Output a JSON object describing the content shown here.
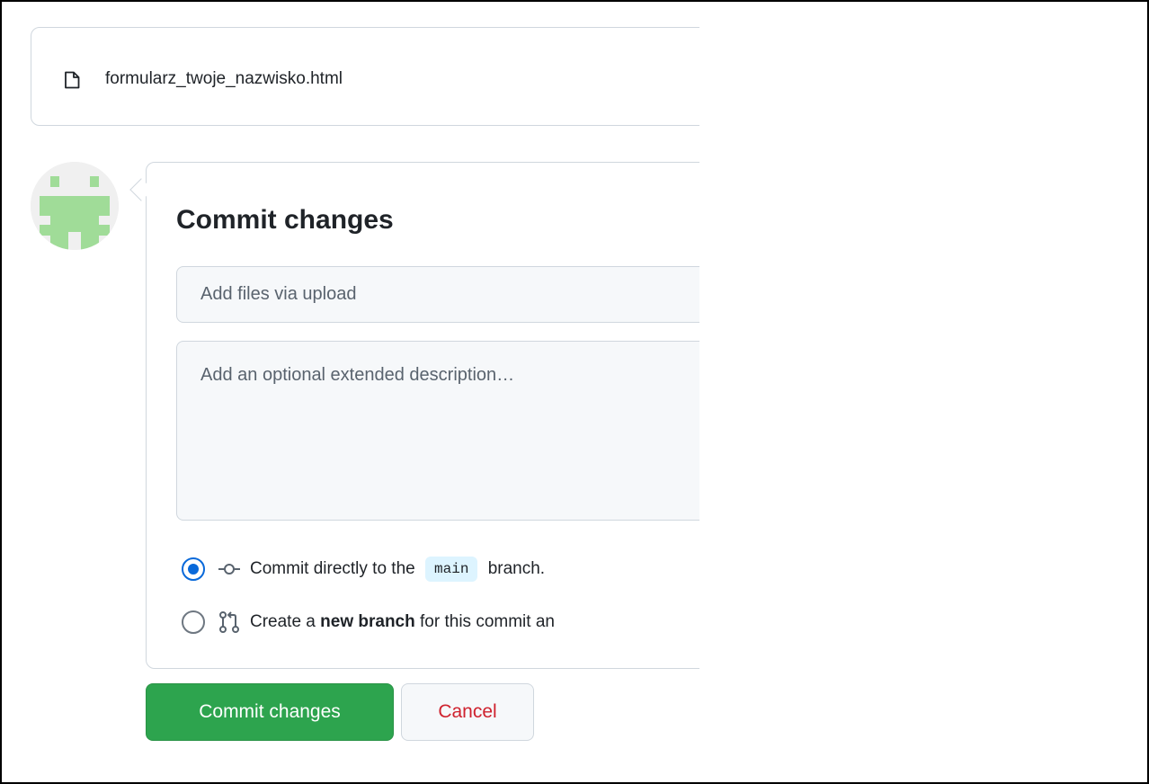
{
  "file": {
    "name": "formularz_twoje_nazwisko.html",
    "icon": "file-icon"
  },
  "avatar": {
    "icon": "identicon-avatar",
    "color": "#a0dc98"
  },
  "commit": {
    "title": "Commit changes",
    "summary_placeholder": "Add files via upload",
    "summary_value": "",
    "description_placeholder": "Add an optional extended description…",
    "description_value": ""
  },
  "options": {
    "direct": {
      "selected": true,
      "icon": "git-commit-icon",
      "text_before": "Commit directly to the",
      "branch": "main",
      "text_after": "branch."
    },
    "new_branch": {
      "selected": false,
      "icon": "git-pull-request-icon",
      "text_before": "Create a",
      "bold": "new branch",
      "text_after": "for this commit an"
    }
  },
  "buttons": {
    "commit_label": "Commit changes",
    "cancel_label": "Cancel"
  },
  "colors": {
    "primary_green": "#2da44e",
    "danger_red": "#cf222e",
    "accent_blue": "#0969da",
    "branch_pill_bg": "#ddf4ff"
  }
}
